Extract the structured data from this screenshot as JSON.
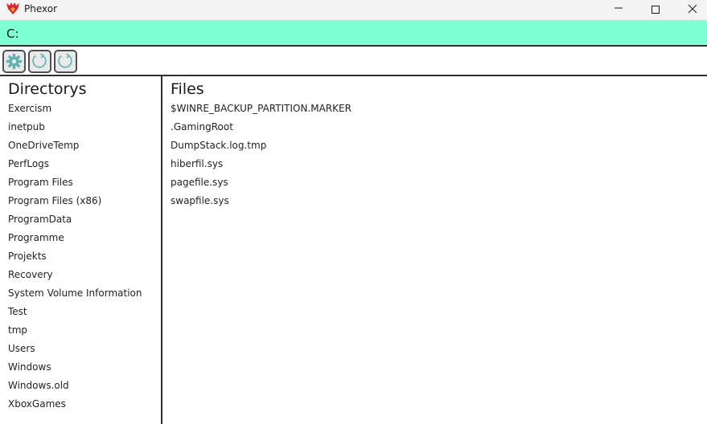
{
  "window": {
    "title": "Phexor",
    "icons": {
      "app": "phexor-logo-icon",
      "minimize": "minimize-icon",
      "maximize": "maximize-icon",
      "close": "close-icon"
    }
  },
  "path_bar": {
    "value": "C:",
    "color": "#7fffd4"
  },
  "toolbar": {
    "buttons": [
      {
        "icon": "gear-icon",
        "color": "#5fb3b3"
      },
      {
        "icon": "refresh-icon",
        "color": "#5fb3b3"
      },
      {
        "icon": "refresh-icon",
        "color": "#5fb3b3"
      }
    ]
  },
  "directories": {
    "heading": "Directorys",
    "items": [
      "Exercism",
      "inetpub",
      "OneDriveTemp",
      "PerfLogs",
      "Program Files",
      "Program Files (x86)",
      "ProgramData",
      "Programme",
      "Projekts",
      "Recovery",
      "System Volume Information",
      "Test",
      "tmp",
      "Users",
      "Windows",
      "Windows.old",
      "XboxGames"
    ]
  },
  "files": {
    "heading": "Files",
    "items": [
      "$WINRE_BACKUP_PARTITION.MARKER",
      ".GamingRoot",
      "DumpStack.log.tmp",
      "hiberfil.sys",
      "pagefile.sys",
      "swapfile.sys"
    ]
  }
}
